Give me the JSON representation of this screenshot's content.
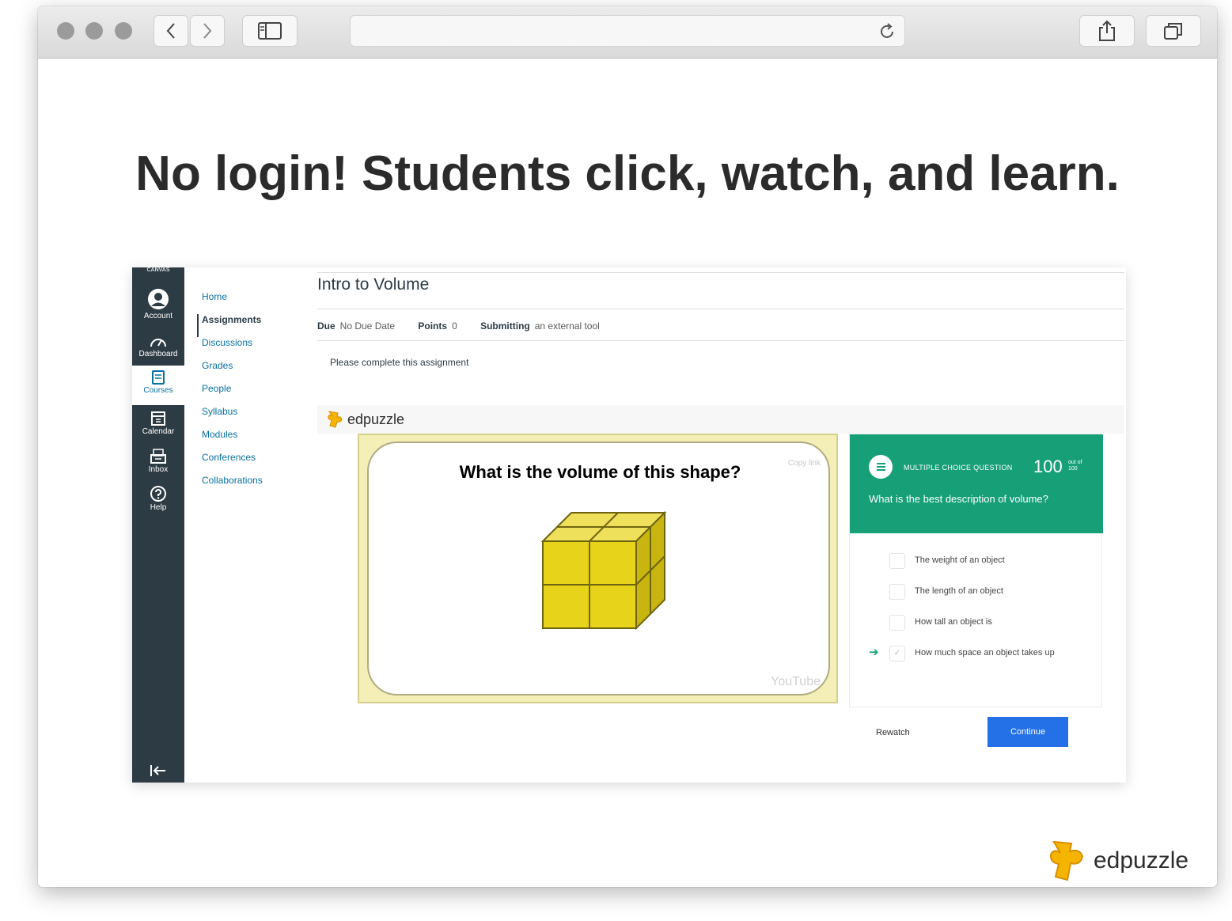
{
  "slide": {
    "headline": "No login! Students click, watch, and learn."
  },
  "canvas": {
    "logo_text": "CANVAS",
    "global_nav": [
      {
        "label": "Account",
        "icon": "account-icon"
      },
      {
        "label": "Dashboard",
        "icon": "dashboard-icon"
      },
      {
        "label": "Courses",
        "icon": "courses-icon",
        "active": true
      },
      {
        "label": "Calendar",
        "icon": "calendar-icon"
      },
      {
        "label": "Inbox",
        "icon": "inbox-icon"
      },
      {
        "label": "Help",
        "icon": "help-icon"
      }
    ],
    "course_nav": [
      "Home",
      "Assignments",
      "Discussions",
      "Grades",
      "People",
      "Syllabus",
      "Modules",
      "Conferences",
      "Collaborations"
    ],
    "course_nav_active": "Assignments",
    "assignment": {
      "title": "Intro to Volume",
      "due_label": "Due",
      "due_value": "No Due Date",
      "points_label": "Points",
      "points_value": "0",
      "submitting_label": "Submitting",
      "submitting_value": "an external tool",
      "instructions": "Please complete this assignment"
    }
  },
  "edpuzzle": {
    "bar_logo": "edpuzzle",
    "video": {
      "question": "What is the volume of this shape?",
      "copy_link": "Copy link",
      "youtube": "YouTube"
    },
    "question_card": {
      "type": "MULTIPLE CHOICE QUESTION",
      "points": "100",
      "points_suffix": "out of 100",
      "text": "What is the best description of volume?",
      "options": [
        "The weight of an object",
        "The length of an object",
        "How tall an object is",
        "How much space an object takes up"
      ],
      "selected_index": 3
    },
    "rewatch_label": "Rewatch",
    "continue_label": "Continue"
  },
  "brand": {
    "name": "edpuzzle"
  },
  "colors": {
    "canvas_nav": "#2d3b45",
    "canvas_link": "#0770a3",
    "edpuzzle_green": "#17a077",
    "continue_blue": "#2470e6",
    "cube_yellow": "#e7d31a",
    "logo_orange": "#f5b400"
  }
}
